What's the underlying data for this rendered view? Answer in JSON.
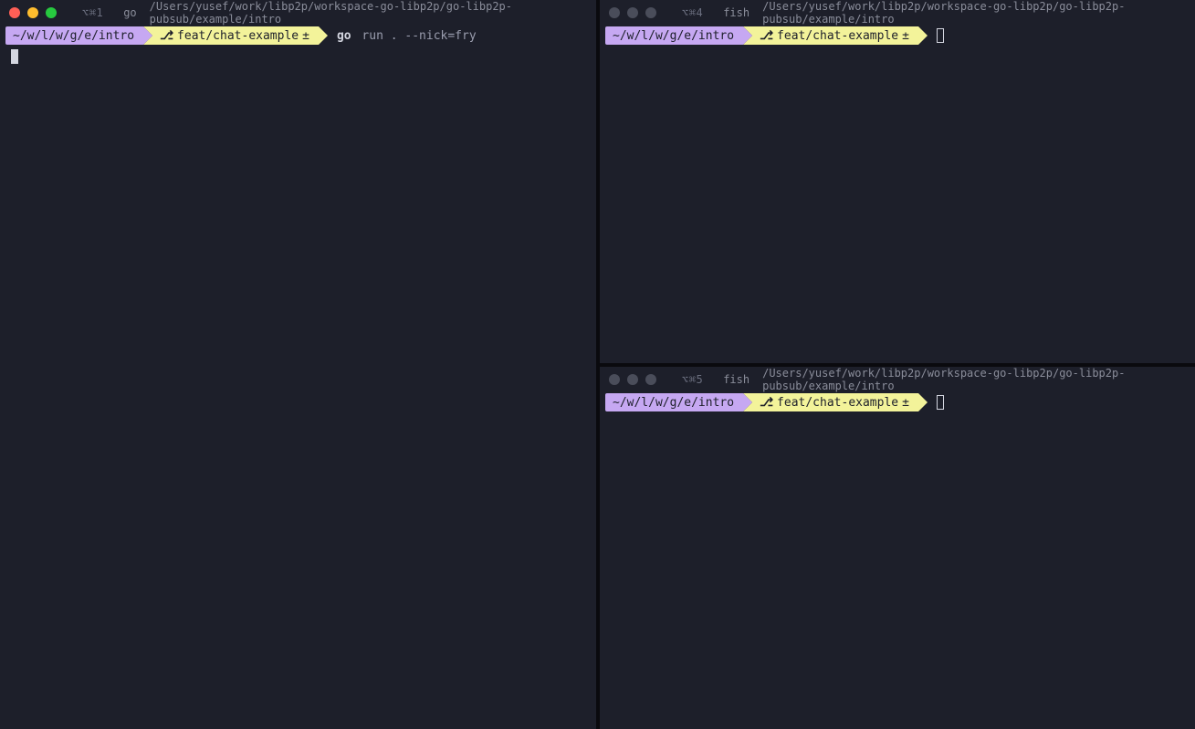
{
  "panes": {
    "left": {
      "shortcut": "⌥⌘1",
      "shell": "go",
      "path": "/Users/yusef/work/libp2p/workspace-go-libp2p/go-libp2p-pubsub/example/intro",
      "active": true,
      "prompt": {
        "cwd": "~/w/l/w/g/e/intro",
        "branch": "feat/chat-example",
        "dirty": "±"
      },
      "command": {
        "bin": "go",
        "args": "run . --nick=fry"
      },
      "show_block_cursor": true
    },
    "top_right": {
      "shortcut": "⌥⌘4",
      "shell": "fish",
      "path": "/Users/yusef/work/libp2p/workspace-go-libp2p/go-libp2p-pubsub/example/intro",
      "active": false,
      "prompt": {
        "cwd": "~/w/l/w/g/e/intro",
        "branch": "feat/chat-example",
        "dirty": "±"
      },
      "show_outline_cursor": true
    },
    "bottom_right": {
      "shortcut": "⌥⌘5",
      "shell": "fish",
      "path": "/Users/yusef/work/libp2p/workspace-go-libp2p/go-libp2p-pubsub/example/intro",
      "active": false,
      "prompt": {
        "cwd": "~/w/l/w/g/e/intro",
        "branch": "feat/chat-example",
        "dirty": "±"
      },
      "show_outline_cursor": true
    }
  }
}
